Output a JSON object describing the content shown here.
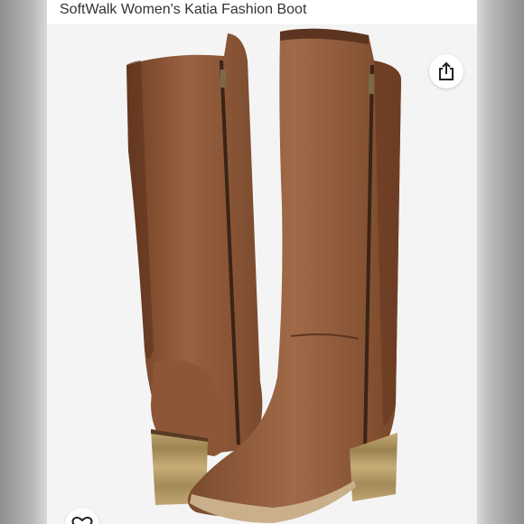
{
  "product": {
    "title": "SoftWalk Women's Katia Fashion Boot"
  },
  "icons": {
    "share": "share-icon",
    "like": "heart-icon"
  },
  "colors": {
    "leather": "#8a5436",
    "heel": "#b89a64",
    "background": "#f4f4f4"
  }
}
